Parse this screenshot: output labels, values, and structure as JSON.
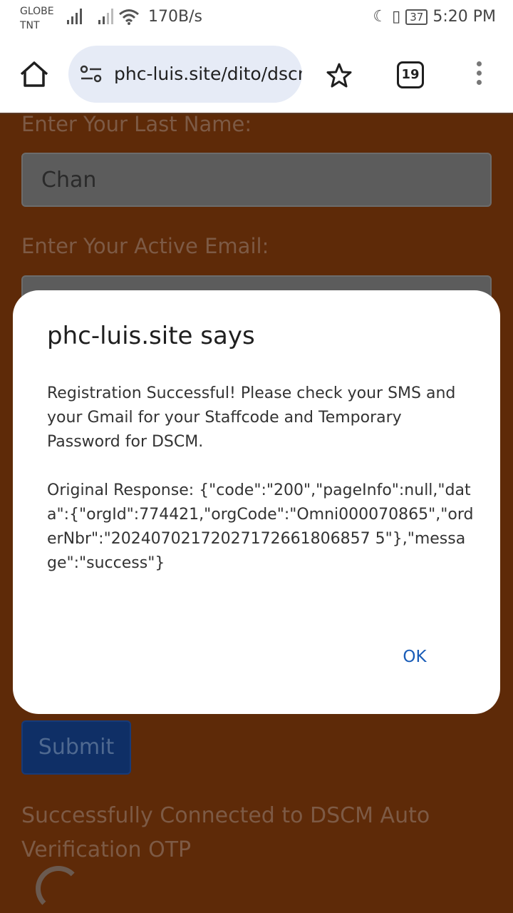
{
  "status_bar": {
    "carrier_line1": "GLOBE",
    "carrier_line2": "TNT",
    "net_speed": "170B/s",
    "battery": "37",
    "time": "5:20 PM"
  },
  "browser": {
    "url": "phc-luis.site/dito/dscm",
    "tab_count": "19"
  },
  "form": {
    "last_name_label": "Enter Your Last Name:",
    "last_name_value": "Chan",
    "email_label": "Enter Your Active Email:",
    "submit_label": "Submit",
    "status_message": "Successfully Connected to DSCM Auto Verification OTP"
  },
  "dialog": {
    "title": "phc-luis.site says",
    "message": "Registration Successful! Please check your SMS and your Gmail for your Staffcode and Temporary Password for DSCM.",
    "response": "Original Response: {\"code\":\"200\",\"pageInfo\":null,\"data\":{\"orgId\":774421,\"orgCode\":\"Omni000070865\",\"orderNbr\":\"20240702172027172661806857 5\"},\"message\":\"success\"}",
    "ok_label": "OK"
  }
}
